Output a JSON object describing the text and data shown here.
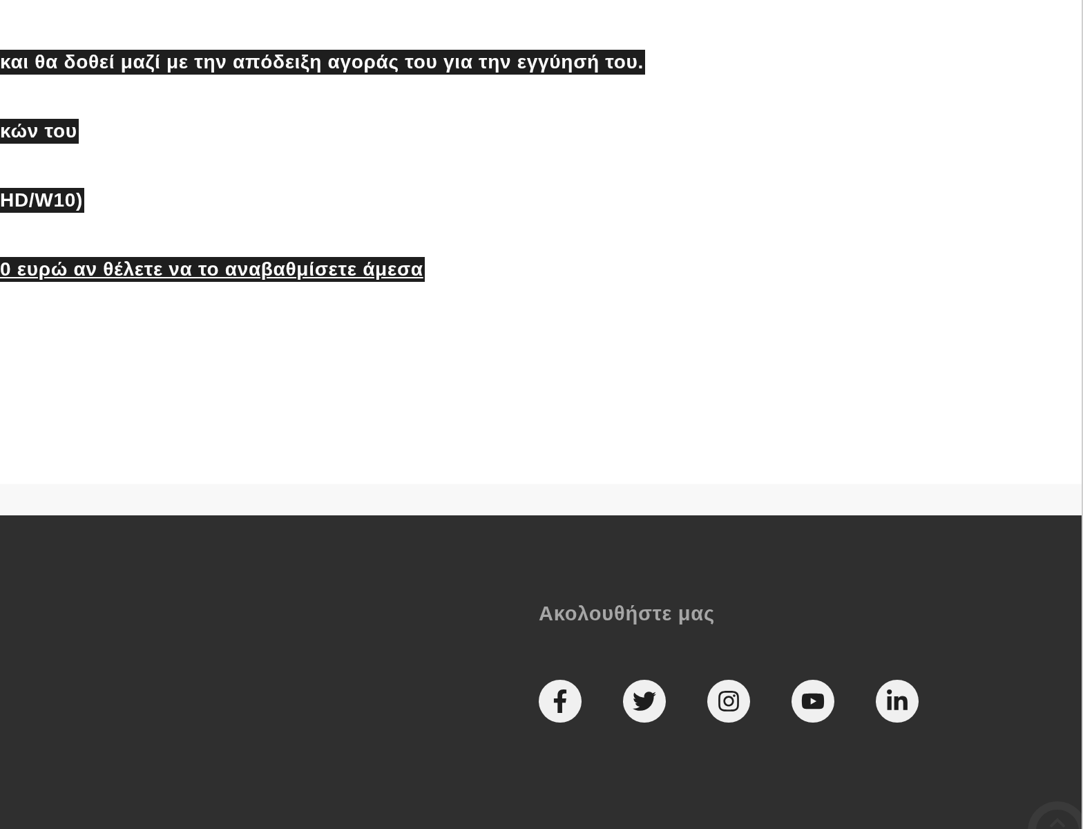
{
  "content": {
    "lines": [
      {
        "text": "και θα δοθεί μαζί με την απόδειξη αγοράς του για την εγγύησή του.",
        "kind": "text"
      },
      {
        "text": "κών του",
        "kind": "text"
      },
      {
        "text": "HD/W10)",
        "kind": "text"
      },
      {
        "text": "0 ευρώ αν θέλετε να το αναβαθμίσετε άμεσα",
        "kind": "link"
      }
    ]
  },
  "footer": {
    "heading": "Ακολουθήστε μας",
    "social": [
      {
        "kind": "facebook"
      },
      {
        "kind": "twitter"
      },
      {
        "kind": "instagram"
      },
      {
        "kind": "youtube"
      },
      {
        "kind": "linkedin"
      }
    ]
  }
}
